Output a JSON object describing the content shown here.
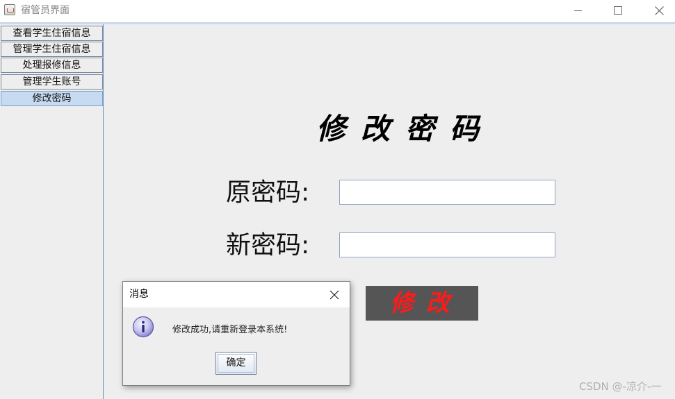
{
  "window": {
    "title": "宿管员界面",
    "controls": {
      "minimize": "minimize-icon",
      "maximize": "maximize-icon",
      "close": "close-icon"
    }
  },
  "sidebar": {
    "items": [
      {
        "label": "查看学生住宿信息",
        "active": false
      },
      {
        "label": "管理学生住宿信息",
        "active": false
      },
      {
        "label": "处理报修信息",
        "active": false
      },
      {
        "label": "管理学生账号",
        "active": false
      },
      {
        "label": "修改密码",
        "active": true
      }
    ]
  },
  "main": {
    "heading": "修改密码",
    "old_password_label": "原密码:",
    "old_password_value": "",
    "new_password_label": "新密码:",
    "new_password_value": "",
    "submit_label": "修改"
  },
  "dialog": {
    "title": "消息",
    "icon": "info-icon",
    "message": "修改成功,请重新登录本系统!",
    "ok_label": "确定"
  },
  "watermark": "CSDN @-凉介-一",
  "colors": {
    "active_nav": "#c6dbf1",
    "submit_bg": "#555555",
    "submit_text": "#ff1a1a",
    "title_accent": "#c9d9ec"
  }
}
